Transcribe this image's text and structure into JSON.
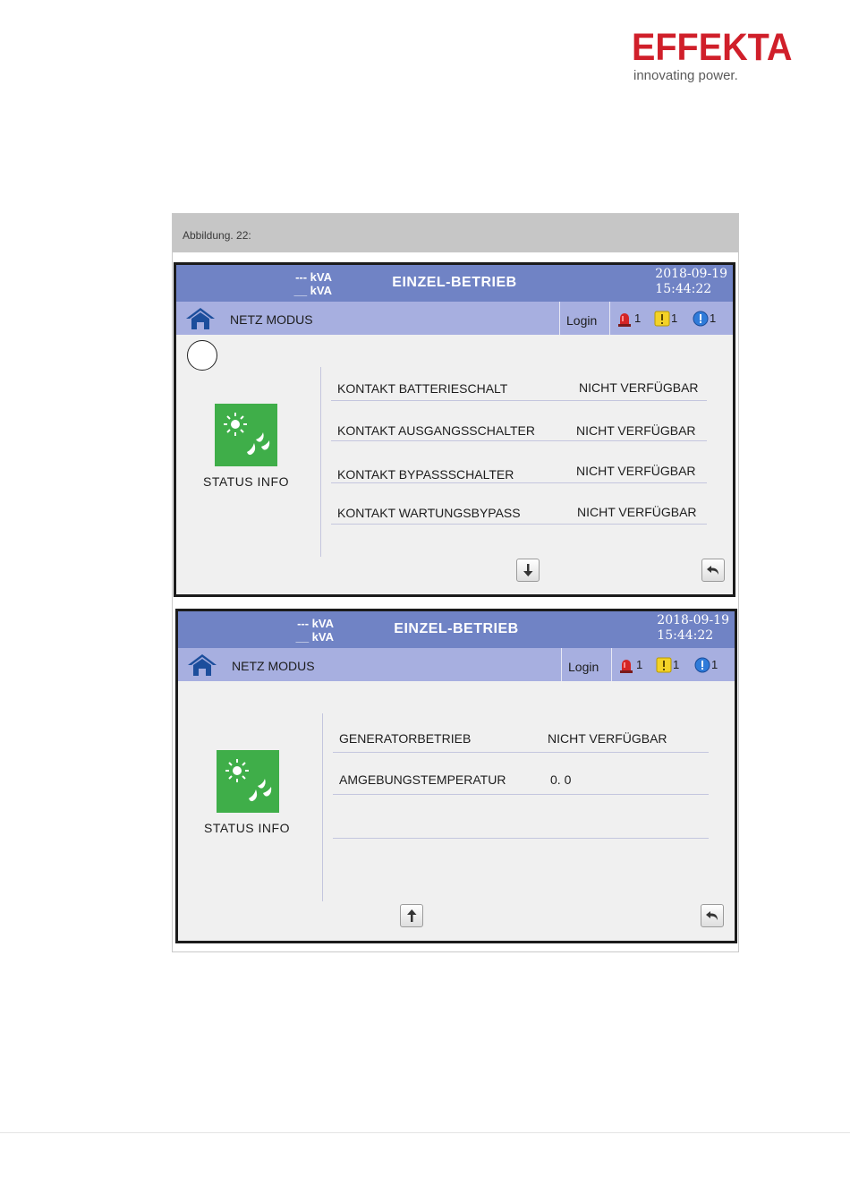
{
  "brand": {
    "name": "EFFEKTA",
    "tagline": "innovating power.",
    "color": "#d01f2a"
  },
  "figure": {
    "caption": "Abbildung. 22:"
  },
  "screens": [
    {
      "kva_line1": "--- kVA",
      "kva_line2": "__ kVA",
      "title": "EINZEL-BETRIEB",
      "date": "2018-09-19",
      "time": "15:44:22",
      "mode": "NETZ MODUS",
      "login": "Login",
      "alarms": {
        "red": "1",
        "yellow": "1",
        "blue": "1"
      },
      "tile_label": "STATUS INFO",
      "rows": [
        {
          "label": "KONTAKT BATTERIESCHALT",
          "value": "NICHT VERFÜGBAR"
        },
        {
          "label": "KONTAKT AUSGANGSSCHALTER",
          "value": "NICHT VERFÜGBAR"
        },
        {
          "label": "KONTAKT BYPASSSCHALTER",
          "value": "NICHT VERFÜGBAR"
        },
        {
          "label": "KONTAKT WARTUNGSBYPASS",
          "value": "NICHT VERFÜGBAR"
        }
      ]
    },
    {
      "kva_line1": "--- kVA",
      "kva_line2": "__ kVA",
      "title": "EINZEL-BETRIEB",
      "date": "2018-09-19",
      "time": "15:44:22",
      "mode": "NETZ MODUS",
      "login": "Login",
      "alarms": {
        "red": "1",
        "yellow": "1",
        "blue": "1"
      },
      "tile_label": "STATUS INFO",
      "rows": [
        {
          "label": "GENERATORBETRIEB",
          "value": "NICHT VERFÜGBAR"
        },
        {
          "label": "AMGEBUNGSTEMPERATUR",
          "value": "0. 0"
        }
      ]
    }
  ],
  "colors": {
    "titlebar": "#7083c5",
    "statusbar": "#a7afe0",
    "tile": "#3fae49"
  },
  "icons": [
    "home-icon",
    "red-alarm-icon",
    "warning-icon",
    "info-icon",
    "sun-droplet-icon",
    "arrow-down-icon",
    "arrow-up-icon",
    "back-icon"
  ]
}
